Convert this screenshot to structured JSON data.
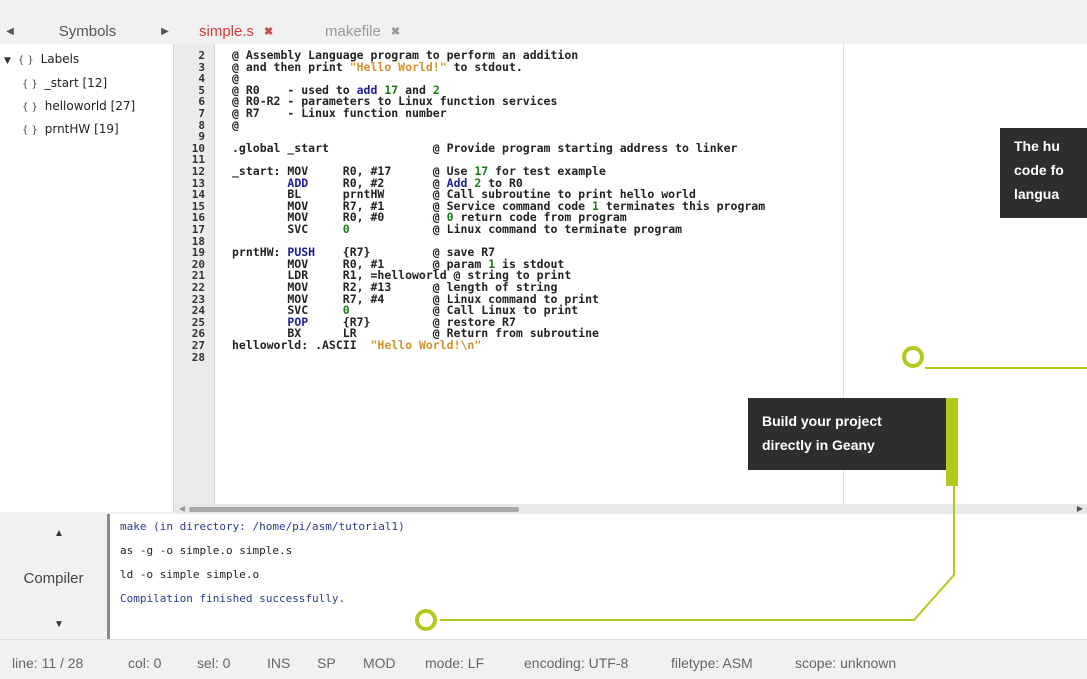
{
  "symbols_panel": {
    "title": "Symbols",
    "tree_root": "Labels",
    "tree_items": [
      "_start [12]",
      "helloworld [27]",
      "prntHW [19]"
    ]
  },
  "tabs": [
    {
      "label": "simple.s",
      "active": true
    },
    {
      "label": "makefile",
      "active": false
    }
  ],
  "editor": {
    "line_numbers": [
      "2",
      "3",
      "4",
      "5",
      "6",
      "7",
      "8",
      "9",
      "10",
      "11",
      "12",
      "13",
      "14",
      "15",
      "16",
      "17",
      "18",
      "19",
      "20",
      "21",
      "22",
      "23",
      "24",
      "25",
      "26",
      "27",
      "28"
    ],
    "lines": [
      [
        {
          "t": "@ Assembly Language program to perform an addition"
        }
      ],
      [
        {
          "t": "@ and then print "
        },
        {
          "t": "\"Hello World!\"",
          "c": "str"
        },
        {
          "t": " to stdout."
        }
      ],
      [
        {
          "t": "@"
        }
      ],
      [
        {
          "t": "@ R0    - used to "
        },
        {
          "t": "add",
          "c": "kw"
        },
        {
          "t": " "
        },
        {
          "t": "17",
          "c": "num"
        },
        {
          "t": " and "
        },
        {
          "t": "2",
          "c": "num"
        }
      ],
      [
        {
          "t": "@ R0-R2 - parameters to Linux function services"
        }
      ],
      [
        {
          "t": "@ R7    - Linux function number"
        }
      ],
      [
        {
          "t": "@"
        }
      ],
      [
        {
          "t": ""
        }
      ],
      [
        {
          "t": ".global _start               @ Provide program starting address to linker"
        }
      ],
      [
        {
          "t": ""
        }
      ],
      [
        {
          "t": "_start: MOV     R0, #17      @ Use "
        },
        {
          "t": "17",
          "c": "num"
        },
        {
          "t": " for test example"
        }
      ],
      [
        {
          "t": "        "
        },
        {
          "t": "ADD",
          "c": "kw"
        },
        {
          "t": "     R0, #2       @ "
        },
        {
          "t": "Add",
          "c": "kw"
        },
        {
          "t": " "
        },
        {
          "t": "2",
          "c": "num"
        },
        {
          "t": " to R0"
        }
      ],
      [
        {
          "t": "        BL      prntHW       @ Call subroutine to print hello world"
        }
      ],
      [
        {
          "t": "        MOV     R7, #1       @ Service command code "
        },
        {
          "t": "1",
          "c": "num"
        },
        {
          "t": " terminates this program"
        }
      ],
      [
        {
          "t": "        MOV     R0, #0       @ "
        },
        {
          "t": "0",
          "c": "num"
        },
        {
          "t": " return code from program"
        }
      ],
      [
        {
          "t": "        SVC     "
        },
        {
          "t": "0",
          "c": "num"
        },
        {
          "t": "            @ Linux command to terminate program"
        }
      ],
      [
        {
          "t": ""
        }
      ],
      [
        {
          "t": "prntHW: "
        },
        {
          "t": "PUSH",
          "c": "kw"
        },
        {
          "t": "    {R7}         @ save R7"
        }
      ],
      [
        {
          "t": "        MOV     R0, #1       @ param "
        },
        {
          "t": "1",
          "c": "num"
        },
        {
          "t": " is stdout"
        }
      ],
      [
        {
          "t": "        LDR     R1, =helloworld @ string to print"
        }
      ],
      [
        {
          "t": "        MOV     R2, #13      @ length of string"
        }
      ],
      [
        {
          "t": "        MOV     R7, #4       @ Linux command to print"
        }
      ],
      [
        {
          "t": "        SVC     "
        },
        {
          "t": "0",
          "c": "num"
        },
        {
          "t": "            @ Call Linux to print"
        }
      ],
      [
        {
          "t": "        "
        },
        {
          "t": "POP",
          "c": "kw"
        },
        {
          "t": "     {R7}         @ restore R7"
        }
      ],
      [
        {
          "t": "        BX      LR           @ Return from subroutine"
        }
      ],
      [
        {
          "t": "helloworld: .ASCII  "
        },
        {
          "t": "\"Hello World!\\n\"",
          "c": "str"
        }
      ],
      [
        {
          "t": ""
        }
      ]
    ]
  },
  "messages": {
    "tab_label": "Compiler",
    "lines": [
      {
        "text": "make (in directory: /home/pi/asm/tutorial1)",
        "color": "#2a3b8f"
      },
      {
        "text": "as -g -o simple.o simple.s",
        "color": "#222222"
      },
      {
        "text": "ld -o simple simple.o",
        "color": "#222222"
      },
      {
        "text": "Compilation finished successfully.",
        "color": "#2a3b8f"
      }
    ]
  },
  "statusbar": {
    "line": "line: 11 / 28",
    "col": "col: 0",
    "sel": "sel: 0",
    "ins": "INS",
    "sp": "SP",
    "mod": "MOD",
    "mode": "mode: LF",
    "encoding": "encoding: UTF-8",
    "filetype": "filetype: ASM",
    "scope": "scope: unknown"
  },
  "callouts": {
    "top_right": [
      "The hu",
      "code fo",
      "langua"
    ],
    "build": [
      "Build your project",
      "directly in Geany"
    ]
  },
  "colors": {
    "accent": "#b5c81e",
    "callout_bg": "#2e2e2e",
    "active_tab": "#d43a3a",
    "inactive_tab": "#9a9a9a",
    "keyword": "#1d1d9c",
    "number": "#1d7a1d",
    "string": "#d4902a"
  }
}
